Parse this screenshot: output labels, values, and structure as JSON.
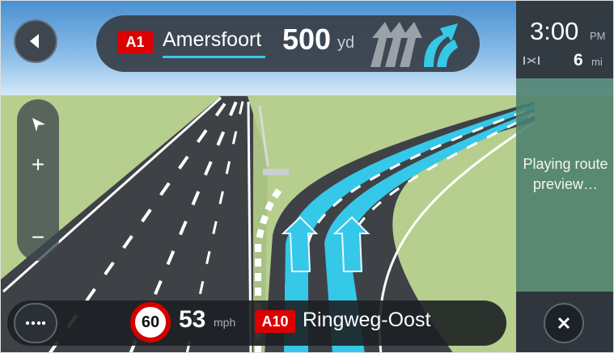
{
  "instruction": {
    "road_number": "A1",
    "destination": "Amersfoort",
    "distance_value": "500",
    "distance_unit": "yd"
  },
  "eta": {
    "time": "3:00",
    "ampm": "PM",
    "remaining_distance": "6",
    "remaining_unit": "mi"
  },
  "preview": {
    "status_text": "Playing route preview…"
  },
  "zoom": {
    "plus_label": "+",
    "minus_label": "−"
  },
  "bottom": {
    "speed_limit": "60",
    "current_speed": "53",
    "speed_unit": "mph",
    "road_number": "A10",
    "street_name": "Ringweg-Oost"
  },
  "icons": {
    "back": "back-arrow-icon",
    "nav": "navigation-arrow-icon",
    "menu": "more-dots-icon",
    "close": "close-icon",
    "lanes": "lane-guidance-icon",
    "remaining": "remaining-distance-icon"
  },
  "colors": {
    "route": "#36c8e8",
    "badge_red": "#dd0000",
    "panel_green": "#4c806c",
    "panel_dark": "#323a42",
    "grass": "#b6cf8e"
  }
}
